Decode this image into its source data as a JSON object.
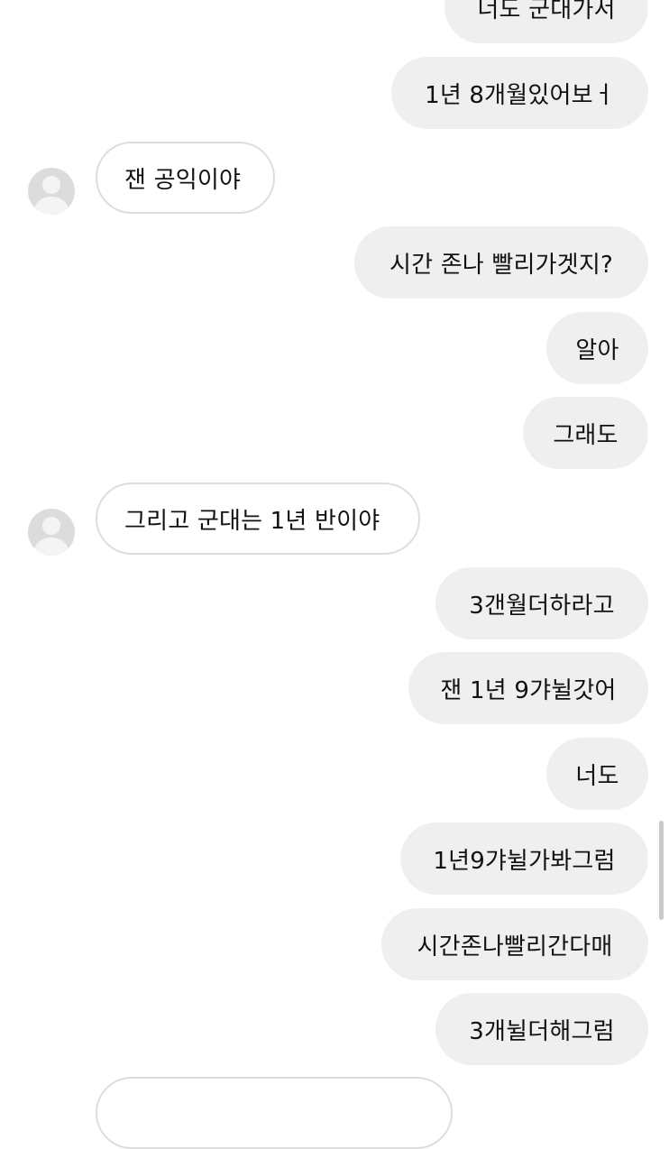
{
  "messages": [
    {
      "side": "sent",
      "text": "너도 군대가서"
    },
    {
      "side": "sent",
      "text": "1년 8개월있어보ㅓ"
    },
    {
      "side": "received",
      "text": "잰 공익이야"
    },
    {
      "side": "sent",
      "text": "시간 존나 빨리가겟지?"
    },
    {
      "side": "sent",
      "text": "알아"
    },
    {
      "side": "sent",
      "text": "그래도"
    },
    {
      "side": "received",
      "text": "그리고 군대는 1년 반이야"
    },
    {
      "side": "sent",
      "text": "3갠월더하라고"
    },
    {
      "side": "sent",
      "text": "잰 1년 9갸뉠갓어"
    },
    {
      "side": "sent",
      "text": "너도"
    },
    {
      "side": "sent",
      "text": "1년9갸뉠가봐그럼"
    },
    {
      "side": "sent",
      "text": "시간존나빨리간다매"
    },
    {
      "side": "sent",
      "text": "3개뉠더해그럼"
    },
    {
      "side": "received",
      "text": ""
    }
  ],
  "icons": {
    "avatar": "default-profile-avatar-icon"
  }
}
